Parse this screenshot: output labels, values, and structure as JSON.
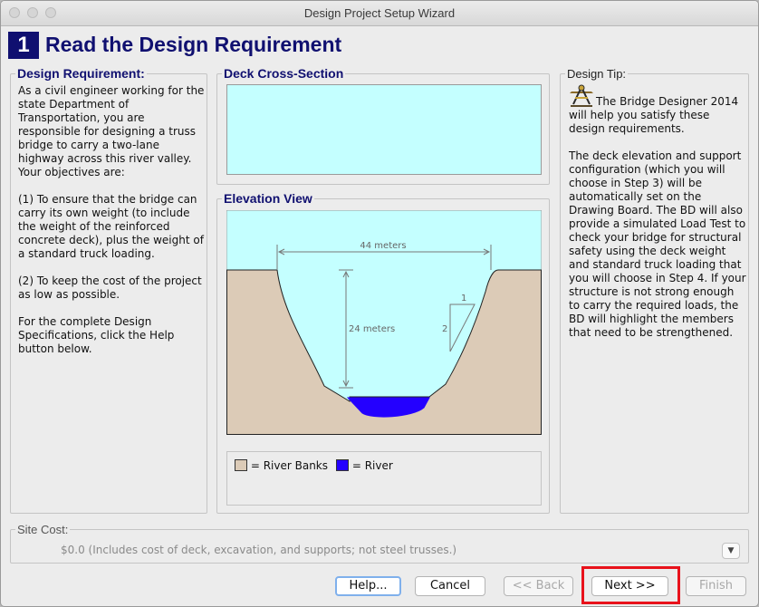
{
  "window": {
    "title": "Design Project Setup Wizard"
  },
  "header": {
    "step_number": "1",
    "title": "Read the Design Requirement"
  },
  "requirement": {
    "heading": "Design Requirement:",
    "para1": "As a civil engineer working for the state Department of Transportation, you are responsible for designing a truss bridge to carry a two-lane highway across this river valley. Your objectives are:",
    "para2": "(1) To ensure that the bridge can carry its own weight (to include the weight of the reinforced concrete deck), plus the weight of a standard truck loading.",
    "para3": "(2) To keep the cost of the project as low as possible.",
    "para4": "For the complete Design Specifications, click the Help button below."
  },
  "deck": {
    "heading": "Deck Cross-Section"
  },
  "elevation": {
    "heading": "Elevation View",
    "span_label": "44 meters",
    "depth_label": "24 meters",
    "slope_run": "1",
    "slope_rise": "2",
    "legend_banks": "= River Banks",
    "legend_river": "= River"
  },
  "tip": {
    "heading": "Design Tip:",
    "para1": "The Bridge Designer 2014 will help you satisfy these design requirements.",
    "para2": "The deck elevation and support configuration (which you will choose in Step 3) will be automatically set on the Drawing Board. The BD will also provide a simulated Load Test to check your bridge for structural safety using the deck weight and standard truck loading that you will choose in Step 4. If your structure is not strong enough to carry the required loads, the BD will highlight the members that need to be strengthened."
  },
  "site_cost": {
    "heading": "Site Cost:",
    "text": "$0.0 (Includes cost of deck, excavation, and supports; not steel trusses.)"
  },
  "buttons": {
    "help": "Help...",
    "cancel": "Cancel",
    "back": "<< Back",
    "next": "Next >>",
    "finish": "Finish"
  },
  "colors": {
    "sky": "#c4ffff",
    "banks": "#dccbb7",
    "river": "#2400ff",
    "title_blue": "#101070",
    "highlight": "#e8121b"
  }
}
